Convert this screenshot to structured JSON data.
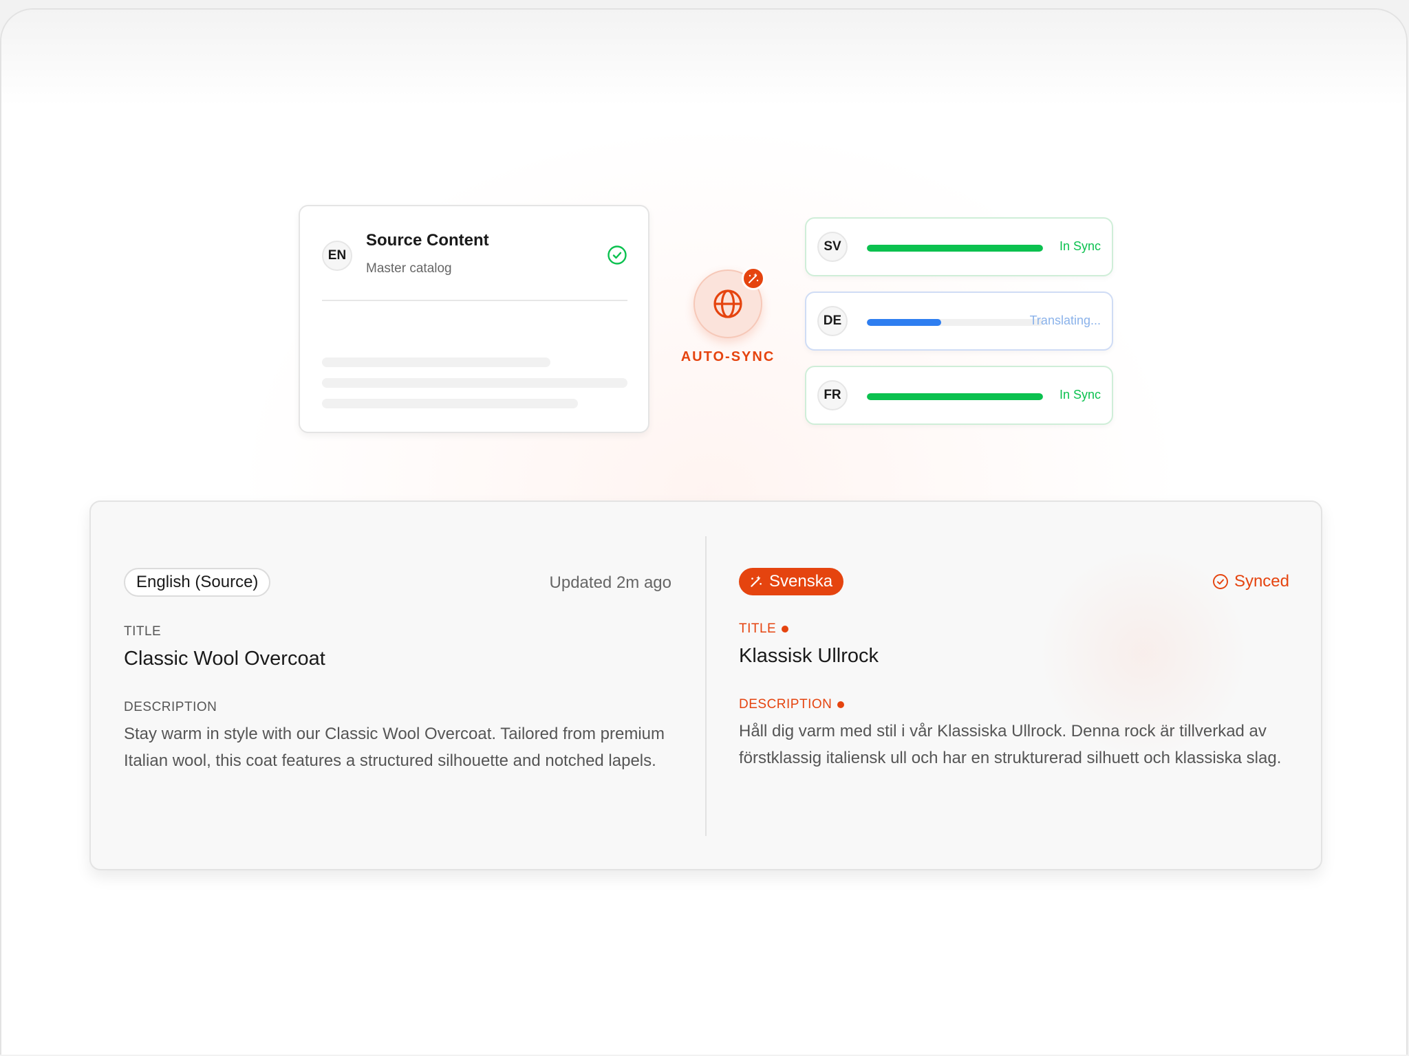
{
  "source_card": {
    "lang_code": "EN",
    "title": "Source Content",
    "subtitle": "Master catalog"
  },
  "hub": {
    "label": "AUTO-SYNC",
    "icon": "globe-icon",
    "badge_icon": "magic-wand-icon"
  },
  "languages": [
    {
      "code": "SV",
      "status": "In Sync",
      "progress": 1.0,
      "color": "#0bc14f",
      "status_color": "#0bc14f"
    },
    {
      "code": "DE",
      "status": "Translating...",
      "progress": 0.42,
      "color": "#2e7ef0",
      "status_color": "#8ab2ea"
    },
    {
      "code": "FR",
      "status": "In Sync",
      "progress": 1.0,
      "color": "#0bc14f",
      "status_color": "#0bc14f"
    }
  ],
  "source_panel": {
    "language": "English (Source)",
    "updated": "Updated 2m ago",
    "title_label": "TITLE",
    "title": "Classic Wool Overcoat",
    "description_label": "DESCRIPTION",
    "description": "Stay warm in style with our Classic Wool Overcoat. Tailored from premium Italian wool, this coat features a structured silhouette and notched lapels."
  },
  "target_panel": {
    "language": "Svenska",
    "status": "Synced",
    "title_label": "TITLE",
    "title": "Klassisk Ullrock",
    "description_label": "DESCRIPTION",
    "description": "Håll dig varm med stil i vår Klassiska Ullrock. Denna rock är tillverkad av förstklassig italiensk ull och har en strukturerad silhuett och klassiska slag."
  },
  "colors": {
    "accent": "#e5440f",
    "success": "#0bc14f",
    "progress_blue": "#2e7ef0"
  }
}
